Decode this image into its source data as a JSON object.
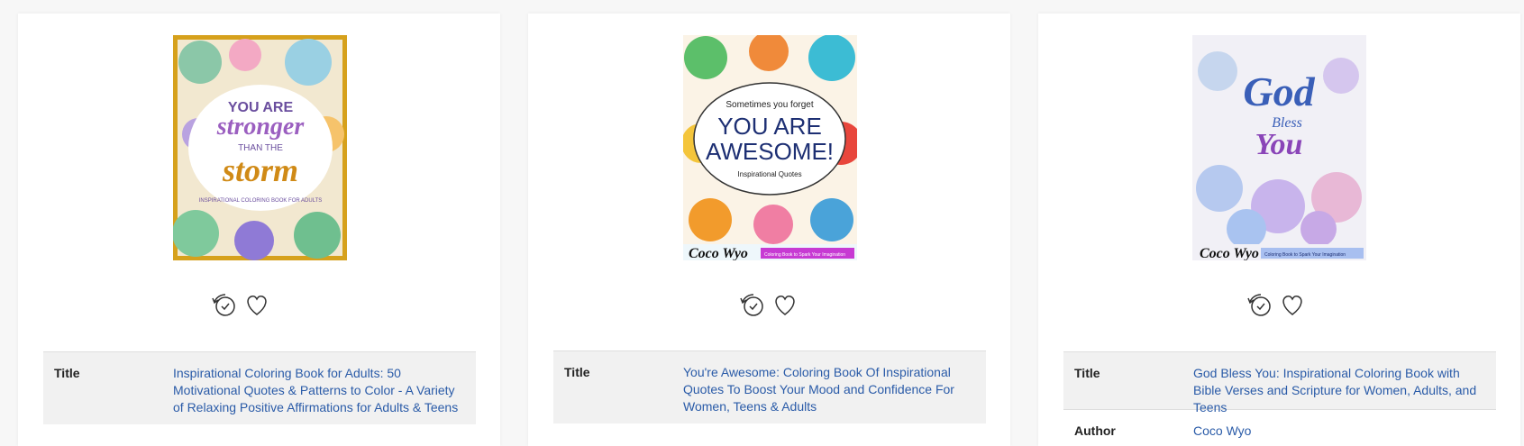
{
  "labels": {
    "title": "Title",
    "author": "Author"
  },
  "icons": {
    "history": "history-icon",
    "favorite": "heart-icon"
  },
  "colors": {
    "link": "#2a5ba8",
    "row_shade": "#f1f1f1",
    "page_bg": "#f7f7f7"
  },
  "books": [
    {
      "title": "Inspirational Coloring Book for Adults: 50 Motivational Quotes & Patterns to Color - A Variety of Relaxing Positive Affirmations for Adults & Teens",
      "cover": {
        "lines": [
          "YOU ARE",
          "stronger",
          "THAN THE",
          "storm",
          "INSPIRATIONAL COLORING BOOK FOR ADULTS"
        ]
      }
    },
    {
      "title": "You're Awesome: Coloring Book Of Inspirational Quotes To Boost Your Mood and Confidence For Women, Teens & Adults",
      "cover": {
        "lines": [
          "Sometimes you forget",
          "YOU ARE",
          "AWESOME!",
          "Inspirational Quotes",
          "Coco Wyo",
          "Coloring Book to Spark Your Imagination"
        ]
      }
    },
    {
      "title": "God Bless You: Inspirational Coloring Book with Bible Verses and Scripture for Women, Adults, and Teens",
      "author": "Coco Wyo",
      "cover": {
        "lines": [
          "God",
          "Bless",
          "You",
          "Coco Wyo",
          "Coloring Book to Spark Your Imagination"
        ]
      }
    }
  ]
}
